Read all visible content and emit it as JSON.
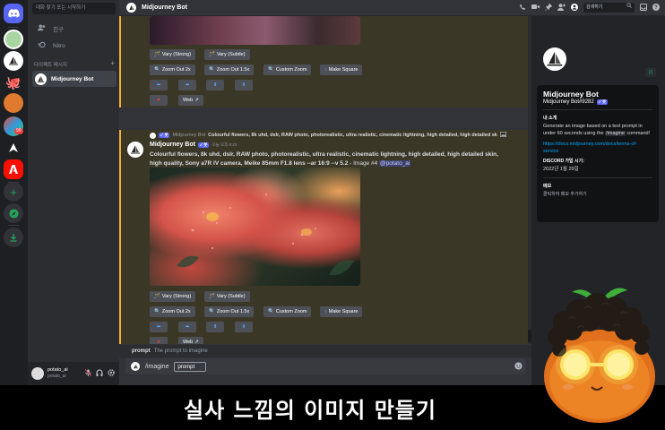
{
  "sidebar": {
    "search_placeholder": "대화 찾기 또는 시작하기",
    "friends": "친구",
    "nitro": "Nitro",
    "dm_header": "다이렉트 메시지",
    "dm_add": "+",
    "dm_user": "Midjourney Bot",
    "user": {
      "name": "potato_ai",
      "tag": "potato_ai"
    },
    "badge": "99"
  },
  "header": {
    "title": "Midjourney Bot",
    "search_placeholder": "검색하기"
  },
  "buttons": {
    "vary_strong": "Vary (Strong)",
    "vary_subtle": "Vary (Subtle)",
    "zoom_2x": "Zoom Out 2x",
    "zoom_15x": "Zoom Out 1.5x",
    "custom_zoom": "Custom Zoom",
    "make_square": "Make Square",
    "arrow_left": "⬅",
    "arrow_right": "➡",
    "arrow_up": "⬆",
    "arrow_down": "⬇",
    "web": "Web"
  },
  "message": {
    "reply_author": "Midjourney Bot",
    "reply_text": "Colourful flowers, 8k uhd, dslr, RAW photo, photorealistic, ultra realistic, cinematic lightning, high detailed, high detailed sk",
    "author": "Midjourney Bot",
    "bot_tag": "✓ 봇",
    "time": "오늘 오후 8:23",
    "content_bold": "Colourful flowers, 8k uhd, dslr, RAW photo, photorealistic, ultra realistic, cinematic lightning, high detailed, high detailed skin, high quality, Sony a7R IV camera, Meike 85mm F1.8 lens --ar 16:9 --v 5.2",
    "content_suffix": " - Image #4 ",
    "mention": "@potato_ai"
  },
  "composer": {
    "hint_name": "prompt",
    "hint_desc": "The prompt to imagine",
    "command": "/imagine",
    "field": "prompt"
  },
  "profile": {
    "name": "Midjourney Bot",
    "username": "Midjourney Bot#9282",
    "bot_tag": "✓ 봇",
    "about_heading": "내 소개",
    "about_text_1": "Generate an image based on a text prompt in under 60 seconds using the ",
    "about_cmd": "/imagine",
    "about_text_2": " command!",
    "link": "https://docs.midjourney.com/docs/terms-of-service",
    "joined_heading": "DISCORD 가입 시기:",
    "joined_date": "2022년 1월 29일",
    "note_heading": "메모",
    "note_placeholder": "클릭하여 메모 추가하기"
  },
  "caption": "실사 느낌의 이미지 만들기",
  "colors": {
    "accent": "#5865f2",
    "mention_bar": "#f0b232",
    "link": "#00a8fc"
  }
}
